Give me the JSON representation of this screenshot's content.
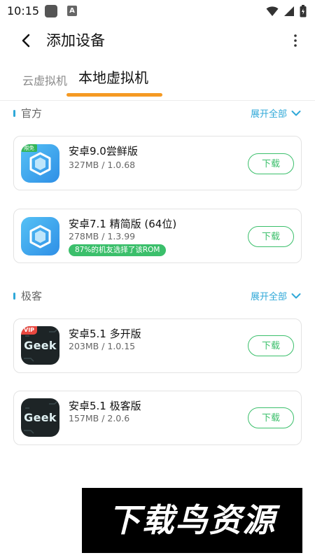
{
  "status_bar": {
    "time": "10:15"
  },
  "header": {
    "title": "添加设备"
  },
  "tabs": [
    {
      "label": "云虚拟机"
    },
    {
      "label": "本地虚拟机"
    }
  ],
  "sections": [
    {
      "title": "官方",
      "expand_label": "展开全部",
      "items": [
        {
          "name": "安卓9.0尝鲜版",
          "meta": "327MB / 1.0.68",
          "badge": "限免",
          "button": "下载"
        },
        {
          "name": "安卓7.1 精简版 (64位)",
          "meta": "278MB / 1.3.99",
          "rom_note": "87%的机友选择了该ROM",
          "button": "下载"
        }
      ]
    },
    {
      "title": "极客",
      "expand_label": "展开全部",
      "items": [
        {
          "name": "安卓5.1 多开版",
          "meta": "203MB / 1.0.15",
          "badge": "VIP",
          "icon_text": "Geek",
          "button": "下载"
        },
        {
          "name": "安卓5.1 极客版",
          "meta": "157MB / 2.0.6",
          "icon_text": "Geek",
          "button": "下载"
        }
      ]
    }
  ],
  "watermark": {
    "text": "下载鸟资源"
  },
  "colors": {
    "accent_green": "#3bbf6b",
    "link_blue": "#2fa8d8",
    "tab_indicator": "#f59a23"
  }
}
